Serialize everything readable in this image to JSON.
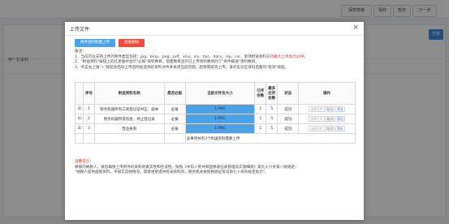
{
  "background": {
    "top_buttons": [
      "保存草稿",
      "保存",
      "暂存",
      "下一步"
    ],
    "side_label": "特一社会科",
    "right_button": "迁移"
  },
  "dialog": {
    "title": "上传文件",
    "close": "×",
    "btn_upload": "附件资料批量上传",
    "btn_delete": "批量删除",
    "notes": {
      "header": "备注：",
      "line1": "1、当前可以支持上传的附件类型包括：jpg、bmp、png、pdf、xlsx、xls、doc、docx、zip、rar，单项附送资料",
      "line1_red": "支持最大上传值为10M。",
      "line2": "2、\"附送资料\"按钮上的红星图中显示\"必报\"资料数目，后面数目显示已上传资料数目的了\"条件报送\"资料数目。",
      "line3": "3、点击右上角\"+\"按钮会启动上传后附加选择的资料文件并关闭当前页面，超限需取消上传，请点击对应资料后面的\"取消\"按钮。"
    },
    "table": {
      "headers": [
        "",
        "序号",
        "附送资料名称",
        "是否必报",
        "当前文件及大小",
        "已传份数",
        "最多应传份数",
        "状态",
        "操作"
      ],
      "rows": [
        {
          "check": "☒",
          "index": "1",
          "name": "税务机器所有工商登记证书正、副本",
          "required": "必报",
          "file": "1.PNG",
          "uploaded": "1",
          "max": "5",
          "status": "成功",
          "ops": [
            "选择文件",
            "取消",
            "预览"
          ]
        },
        {
          "check": "☒",
          "index": "2",
          "name": "税务机器所得房屋、停止登记表",
          "required": "必报",
          "file": "1.PNG",
          "uploaded": "1",
          "max": "5",
          "status": "成功",
          "ops": [
            "选择文件",
            "取消",
            "预览"
          ]
        },
        {
          "check": "☒",
          "index": "3",
          "name": "营业执照",
          "required": "必报",
          "file": "1.PNG",
          "uploaded": "1",
          "max": "5",
          "status": "成功",
          "ops": [
            "选择文件",
            "取消",
            "预览"
          ]
        }
      ],
      "footer": "该事项共有3个附送资料需要上传"
    },
    "notice": {
      "title": "温馨提示：",
      "line1": "尊敬的纳税人，请您确保上传附件的资料的真实性和合法性。按照《中华人民共和国税收征收管理法实施细则》第九十六条第一款规定：",
      "line2": "\"纳税人提供虚假资料，不如实反映情况，或者拒绝提供有关资料的，税务机关依照税收征管法第七十条的规定处罚\"。"
    }
  }
}
